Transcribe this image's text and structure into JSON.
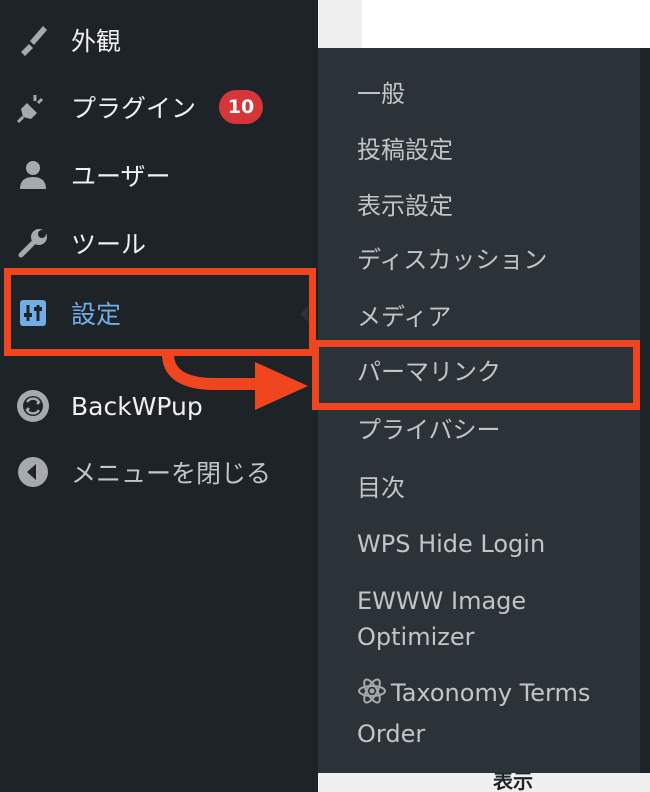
{
  "sidebar": {
    "items": [
      {
        "label": "外観",
        "icon": "paintbrush-icon"
      },
      {
        "label": "プラグイン",
        "icon": "plugin-icon",
        "badge": "10"
      },
      {
        "label": "ユーザー",
        "icon": "user-icon"
      },
      {
        "label": "ツール",
        "icon": "wrench-icon"
      },
      {
        "label": "設定",
        "icon": "settings-sliders-icon",
        "current": true
      },
      {
        "label": "BackWPup",
        "icon": "backwpup-icon"
      },
      {
        "label": "メニューを閉じる",
        "icon": "collapse-arrow-icon"
      }
    ]
  },
  "flyout": {
    "items": [
      {
        "label": "一般"
      },
      {
        "label": "投稿設定"
      },
      {
        "label": "表示設定"
      },
      {
        "label": "ディスカッション"
      },
      {
        "label": "メディア"
      },
      {
        "label": "パーマリンク",
        "highlighted": true
      },
      {
        "label": "プライバシー"
      },
      {
        "label": "目次"
      },
      {
        "label": "WPS Hide Login"
      },
      {
        "label": "EWWW Image",
        "label2": "Optimizer"
      },
      {
        "label": "Taxonomy Terms",
        "label2": "Order",
        "icon": "atom-icon"
      }
    ]
  },
  "page": {
    "partial_text": "表示"
  },
  "colors": {
    "sidebar_bg": "#1d2327",
    "flyout_bg": "#2c3338",
    "text": "#f0f0f1",
    "current": "#72aee6",
    "badge": "#d63638",
    "annotation": "#f0461f"
  }
}
